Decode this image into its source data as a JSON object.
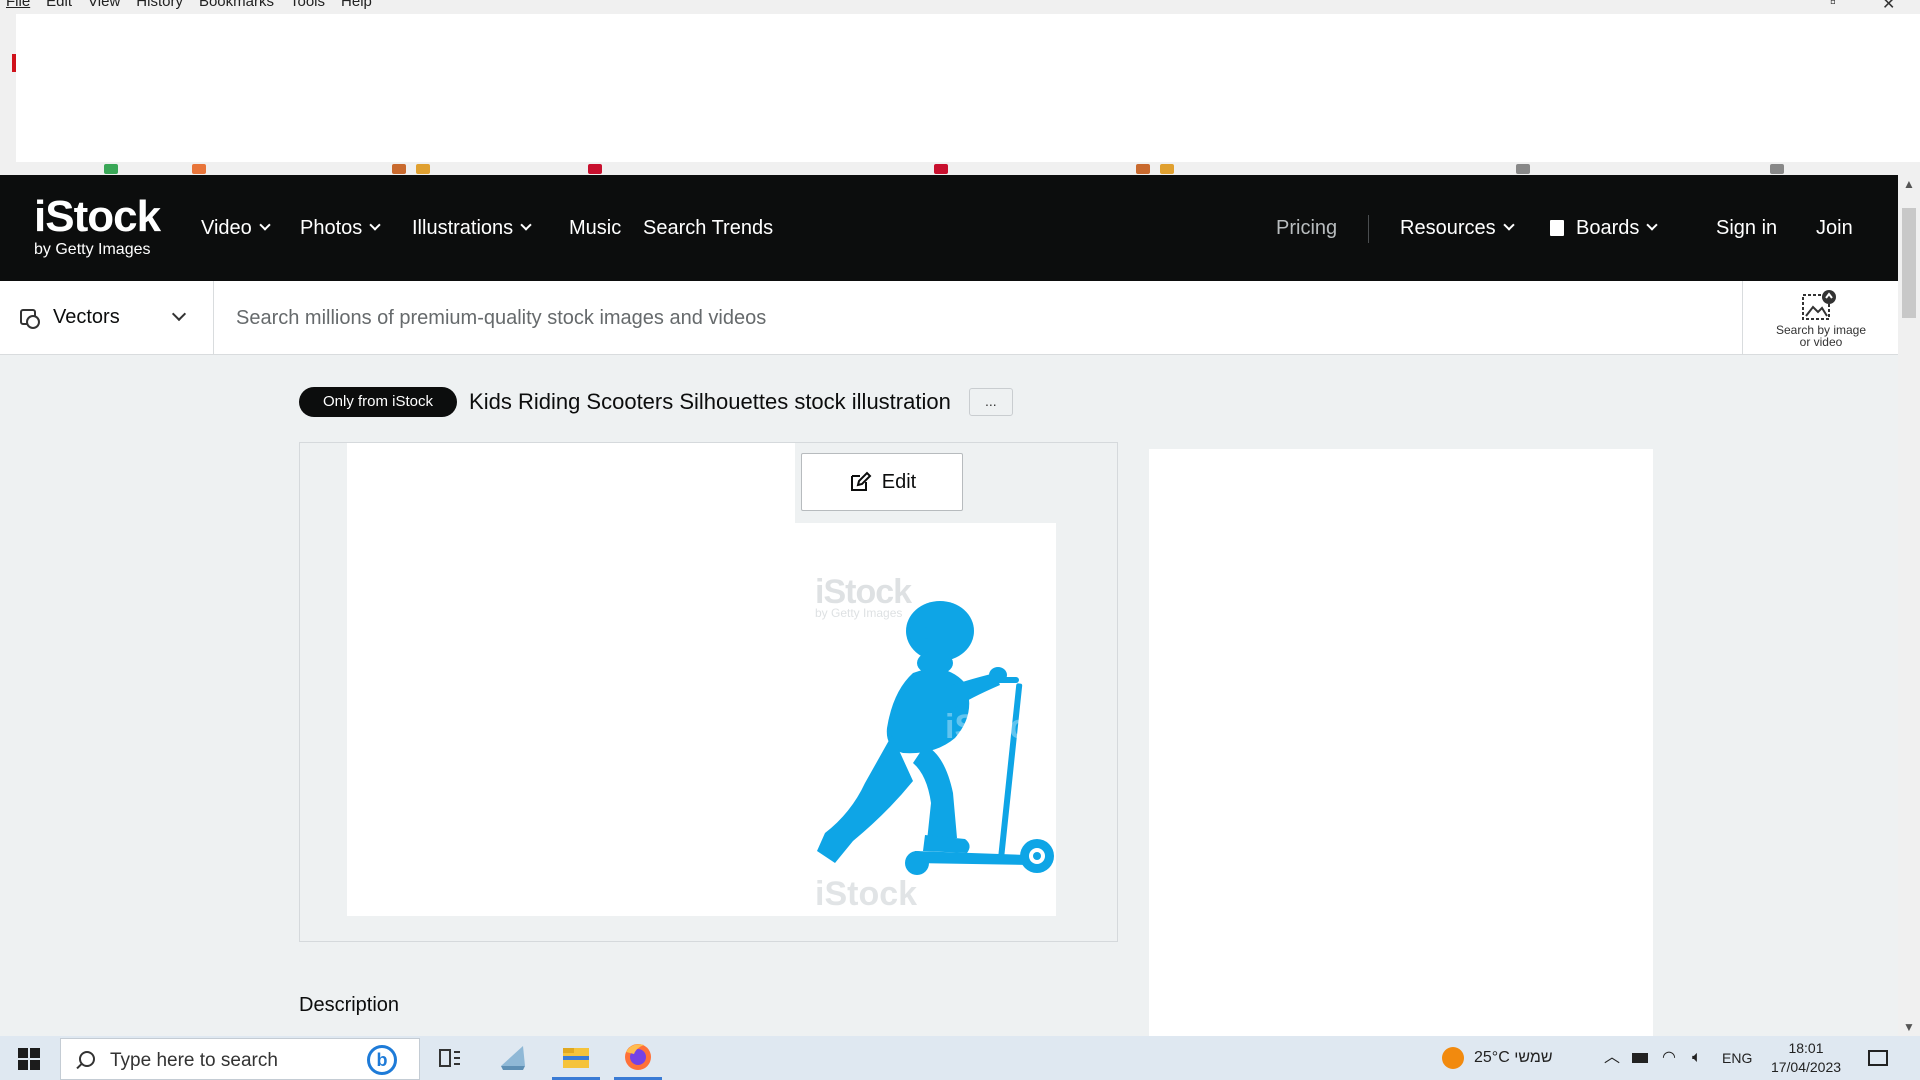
{
  "browser": {
    "menu": [
      "File",
      "Edit",
      "View",
      "History",
      "Bookmarks",
      "Tools",
      "Help"
    ]
  },
  "nav": {
    "logo_main": "iStock",
    "logo_sub": "by Getty Images",
    "video": "Video",
    "photos": "Photos",
    "illustrations": "Illustrations",
    "music": "Music",
    "search_trends": "Search Trends",
    "pricing": "Pricing",
    "resources": "Resources",
    "boards": "Boards",
    "sign_in": "Sign in",
    "join": "Join"
  },
  "search": {
    "filter_label": "Vectors",
    "placeholder": "Search millions of premium-quality stock images and videos",
    "image_search_label_1": "Search by image",
    "image_search_label_2": "or video"
  },
  "asset": {
    "badge": "Only from iStock",
    "title": "Kids Riding Scooters Silhouettes stock illustration",
    "more": "...",
    "edit_label": "Edit",
    "watermark_main": "iStock",
    "watermark_sub": "by Getty Images",
    "silhouette_color": "#0ea5e6",
    "description_heading": "Description"
  },
  "taskbar": {
    "search_placeholder": "Type here to search",
    "weather": "25°C  שמשי",
    "language": "ENG",
    "time": "18:01",
    "date": "17/04/2023"
  }
}
